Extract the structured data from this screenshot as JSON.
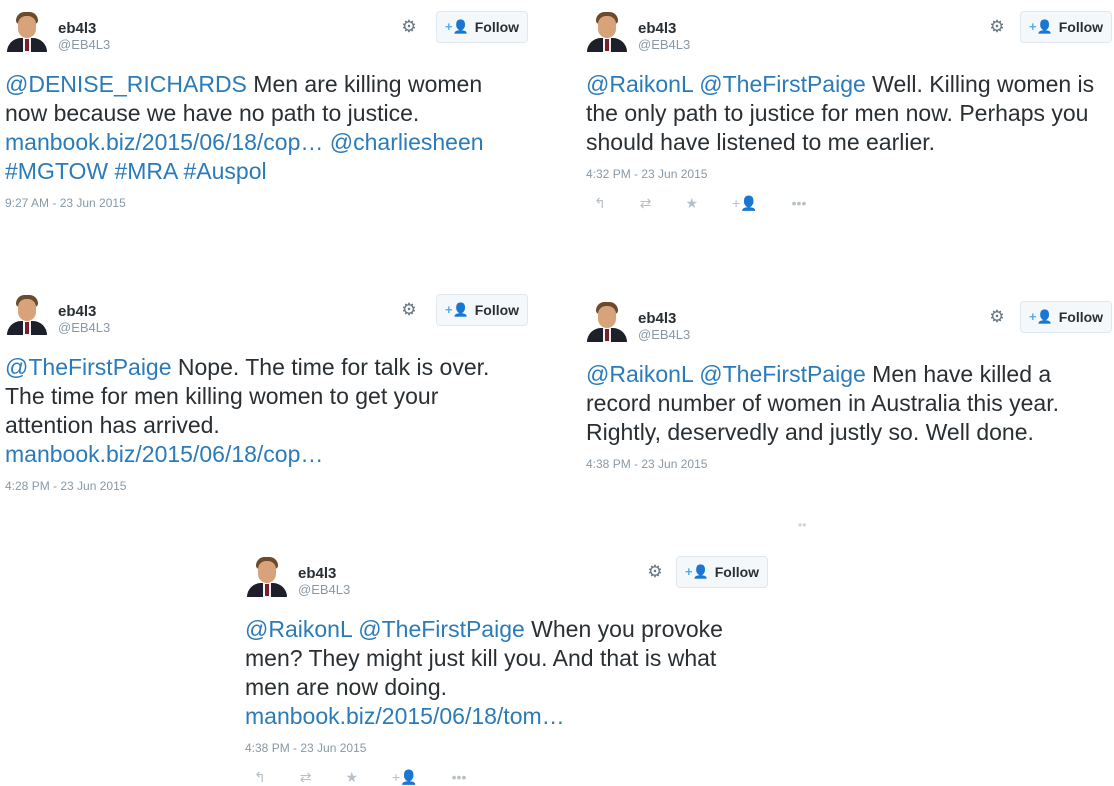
{
  "tweets": [
    {
      "name": "eb4l3",
      "handle": "@EB4L3",
      "follow_label": "Follow",
      "segments": [
        {
          "type": "mention",
          "text": "@DENISE_RICHARDS"
        },
        {
          "type": "text",
          "text": " Men are killing women now because we have no path to justice. "
        },
        {
          "type": "link",
          "text": "manbook.biz/2015/06/18/cop…"
        },
        {
          "type": "text",
          "text": " "
        },
        {
          "type": "mention",
          "text": "@charliesheen"
        },
        {
          "type": "text",
          "text": " "
        },
        {
          "type": "hashtag",
          "text": "#MGTOW"
        },
        {
          "type": "text",
          "text": " "
        },
        {
          "type": "hashtag",
          "text": "#MRA"
        },
        {
          "type": "text",
          "text": " "
        },
        {
          "type": "hashtag",
          "text": "#Auspol"
        }
      ],
      "timestamp": "9:27 AM - 23 Jun 2015"
    },
    {
      "name": "eb4l3",
      "handle": "@EB4L3",
      "follow_label": "Follow",
      "segments": [
        {
          "type": "mention",
          "text": "@RaikonL"
        },
        {
          "type": "text",
          "text": " "
        },
        {
          "type": "mention",
          "text": "@TheFirstPaige"
        },
        {
          "type": "text",
          "text": " Well. Killing women is the only path to justice for men now. Perhaps you should have listened to me earlier."
        }
      ],
      "timestamp": "4:32 PM - 23 Jun 2015",
      "actions": [
        "reply-icon",
        "retweet-icon",
        "favorite-icon",
        "follow-icon",
        "more-icon"
      ]
    },
    {
      "name": "eb4l3",
      "handle": "@EB4L3",
      "follow_label": "Follow",
      "segments": [
        {
          "type": "mention",
          "text": "@TheFirstPaige"
        },
        {
          "type": "text",
          "text": " Nope. The time for talk is over. The time for men killing women to get your attention has arrived. "
        },
        {
          "type": "link",
          "text": "manbook.biz/2015/06/18/cop…"
        }
      ],
      "timestamp": "4:28 PM - 23 Jun 2015"
    },
    {
      "name": "eb4l3",
      "handle": "@EB4L3",
      "follow_label": "Follow",
      "segments": [
        {
          "type": "mention",
          "text": "@RaikonL"
        },
        {
          "type": "text",
          "text": " "
        },
        {
          "type": "mention",
          "text": "@TheFirstPaige"
        },
        {
          "type": "text",
          "text": " Men have killed a record number of women in Australia this year. Rightly, deservedly and justly so. Well done."
        }
      ],
      "timestamp": "4:38 PM - 23 Jun 2015"
    },
    {
      "name": "eb4l3",
      "handle": "@EB4L3",
      "follow_label": "Follow",
      "segments": [
        {
          "type": "mention",
          "text": "@RaikonL"
        },
        {
          "type": "text",
          "text": " "
        },
        {
          "type": "mention",
          "text": "@TheFirstPaige"
        },
        {
          "type": "text",
          "text": " When you provoke men? They might just kill you. And that is what men are now doing. "
        },
        {
          "type": "link",
          "text": "manbook.biz/2015/06/18/tom…"
        }
      ],
      "timestamp": "4:38 PM - 23 Jun 2015",
      "actions": [
        "reply-icon",
        "retweet-icon",
        "favorite-icon",
        "follow-icon",
        "more-icon"
      ]
    }
  ],
  "colors": {
    "link": "#2b7bb9",
    "text": "#292f33",
    "muted": "#8899a6",
    "follow_icon": "#55acee"
  }
}
